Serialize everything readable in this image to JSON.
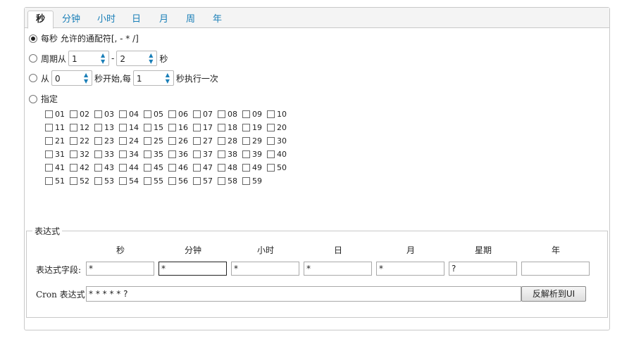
{
  "tabs": [
    "秒",
    "分钟",
    "小时",
    "日",
    "月",
    "周",
    "年"
  ],
  "options": {
    "every": "每秒 允许的通配符[, - * /]",
    "cycle_from": "周期从",
    "cycle_dash": "-",
    "cycle_unit": "秒",
    "cycle_start": "1",
    "cycle_end": "2",
    "from_prefix": "从",
    "from_start": "0",
    "from_mid": "秒开始,每",
    "from_interval": "1",
    "from_suffix": "秒执行一次",
    "specify": "指定"
  },
  "seconds": [
    "01",
    "02",
    "03",
    "04",
    "05",
    "06",
    "07",
    "08",
    "09",
    "10",
    "11",
    "12",
    "13",
    "14",
    "15",
    "16",
    "17",
    "18",
    "19",
    "20",
    "21",
    "22",
    "23",
    "24",
    "25",
    "26",
    "27",
    "28",
    "29",
    "30",
    "31",
    "32",
    "33",
    "34",
    "35",
    "36",
    "37",
    "38",
    "39",
    "40",
    "41",
    "42",
    "43",
    "44",
    "45",
    "46",
    "47",
    "48",
    "49",
    "50",
    "51",
    "52",
    "53",
    "54",
    "55",
    "56",
    "57",
    "58",
    "59"
  ],
  "expression": {
    "legend": "表达式",
    "columns": [
      "秒",
      "分钟",
      "小时",
      "日",
      "月",
      "星期",
      "年"
    ],
    "field_label": "表达式字段:",
    "fields": [
      "*",
      "*",
      "*",
      "*",
      "*",
      "?",
      ""
    ],
    "cron_label": "Cron 表达式:",
    "cron_value": "* * * * * ?",
    "parse_button": "反解析到UI"
  }
}
